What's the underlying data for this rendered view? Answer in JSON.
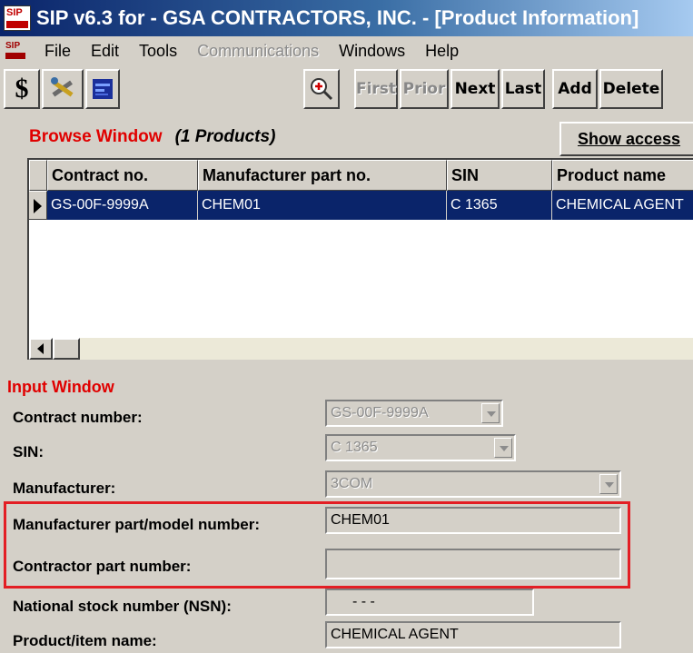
{
  "window": {
    "title": "SIP v6.3 for - GSA CONTRACTORS, INC. - [Product Information]",
    "app_icon": "sip-logo-icon"
  },
  "menu": {
    "items": [
      "File",
      "Edit",
      "Tools",
      "Communications",
      "Windows",
      "Help"
    ],
    "disabled": [
      "Communications"
    ]
  },
  "toolbar": {
    "dollar_label": "$",
    "icons": [
      "dollar-icon",
      "tools-icon",
      "report-icon",
      "zoom-icon"
    ],
    "nav": [
      {
        "label": "First",
        "enabled": false
      },
      {
        "label": "Prior",
        "enabled": false
      },
      {
        "label": "Next",
        "enabled": true
      },
      {
        "label": "Last",
        "enabled": true
      },
      {
        "label": "Add",
        "enabled": true
      },
      {
        "label": "Delete",
        "enabled": true
      }
    ]
  },
  "browse": {
    "title": "Browse Window",
    "count": "(1 Products)",
    "show_access_label": "Show access",
    "columns": [
      "Contract no.",
      "Manufacturer part no.",
      "SIN",
      "Product name"
    ],
    "rows": [
      [
        "GS-00F-9999A",
        "CHEM01",
        "C 1365",
        "CHEMICAL AGENT"
      ]
    ]
  },
  "input": {
    "title": "Input Window",
    "fields": {
      "contract_number": {
        "label": "Contract number:",
        "value": "GS-00F-9999A"
      },
      "sin": {
        "label": "SIN:",
        "value": "C 1365"
      },
      "manufacturer": {
        "label": "Manufacturer:",
        "value": "3COM"
      },
      "mfr_part": {
        "label": "Manufacturer part/model number:",
        "value": "CHEM01"
      },
      "contractor_part": {
        "label": "Contractor part number:",
        "value": ""
      },
      "nsn": {
        "label": "National stock number (NSN):",
        "value": "- - -"
      },
      "product_name": {
        "label": "Product/item name:",
        "value": "CHEMICAL AGENT"
      }
    }
  },
  "colors": {
    "title_bar": "#0a246a",
    "highlight_box": "#e31e24",
    "section_label": "#e00000",
    "selected_row": "#0a246a"
  }
}
